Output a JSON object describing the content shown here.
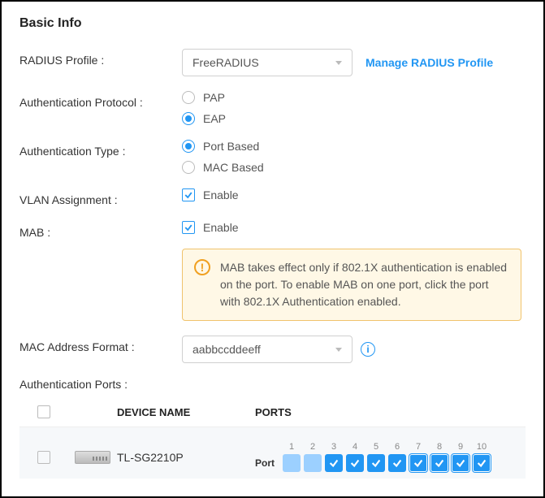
{
  "section_title": "Basic Info",
  "radius_profile": {
    "label": "RADIUS Profile :",
    "selected": "FreeRADIUS",
    "manage_link": "Manage RADIUS Profile"
  },
  "auth_protocol": {
    "label": "Authentication Protocol :",
    "options": {
      "pap": "PAP",
      "eap": "EAP"
    },
    "selected": "eap"
  },
  "auth_type": {
    "label": "Authentication Type :",
    "options": {
      "port": "Port Based",
      "mac": "MAC Based"
    },
    "selected": "port"
  },
  "vlan_assignment": {
    "label": "VLAN Assignment :",
    "enable_text": "Enable",
    "checked": true
  },
  "mab": {
    "label": "MAB :",
    "enable_text": "Enable",
    "checked": true,
    "alert": "MAB takes effect only if 802.1X authentication is enabled on the port. To enable MAB on one port, click the port with 802.1X Authentication enabled."
  },
  "mac_format": {
    "label": "MAC Address Format :",
    "selected": "aabbccddeeff"
  },
  "auth_ports_label": "Authentication Ports :",
  "table": {
    "headers": {
      "device_name": "DEVICE NAME",
      "ports": "PORTS"
    },
    "row": {
      "device_name": "TL-SG2210P",
      "ports_label": "Port",
      "ports": [
        {
          "n": 1,
          "state": "disabled"
        },
        {
          "n": 2,
          "state": "disabled"
        },
        {
          "n": 3,
          "state": "enabled"
        },
        {
          "n": 4,
          "state": "enabled"
        },
        {
          "n": 5,
          "state": "enabled"
        },
        {
          "n": 6,
          "state": "enabled"
        },
        {
          "n": 7,
          "state": "enabled-outlined"
        },
        {
          "n": 8,
          "state": "enabled-outlined"
        },
        {
          "n": 9,
          "state": "enabled-outlined"
        },
        {
          "n": 10,
          "state": "enabled-outlined"
        }
      ]
    }
  }
}
